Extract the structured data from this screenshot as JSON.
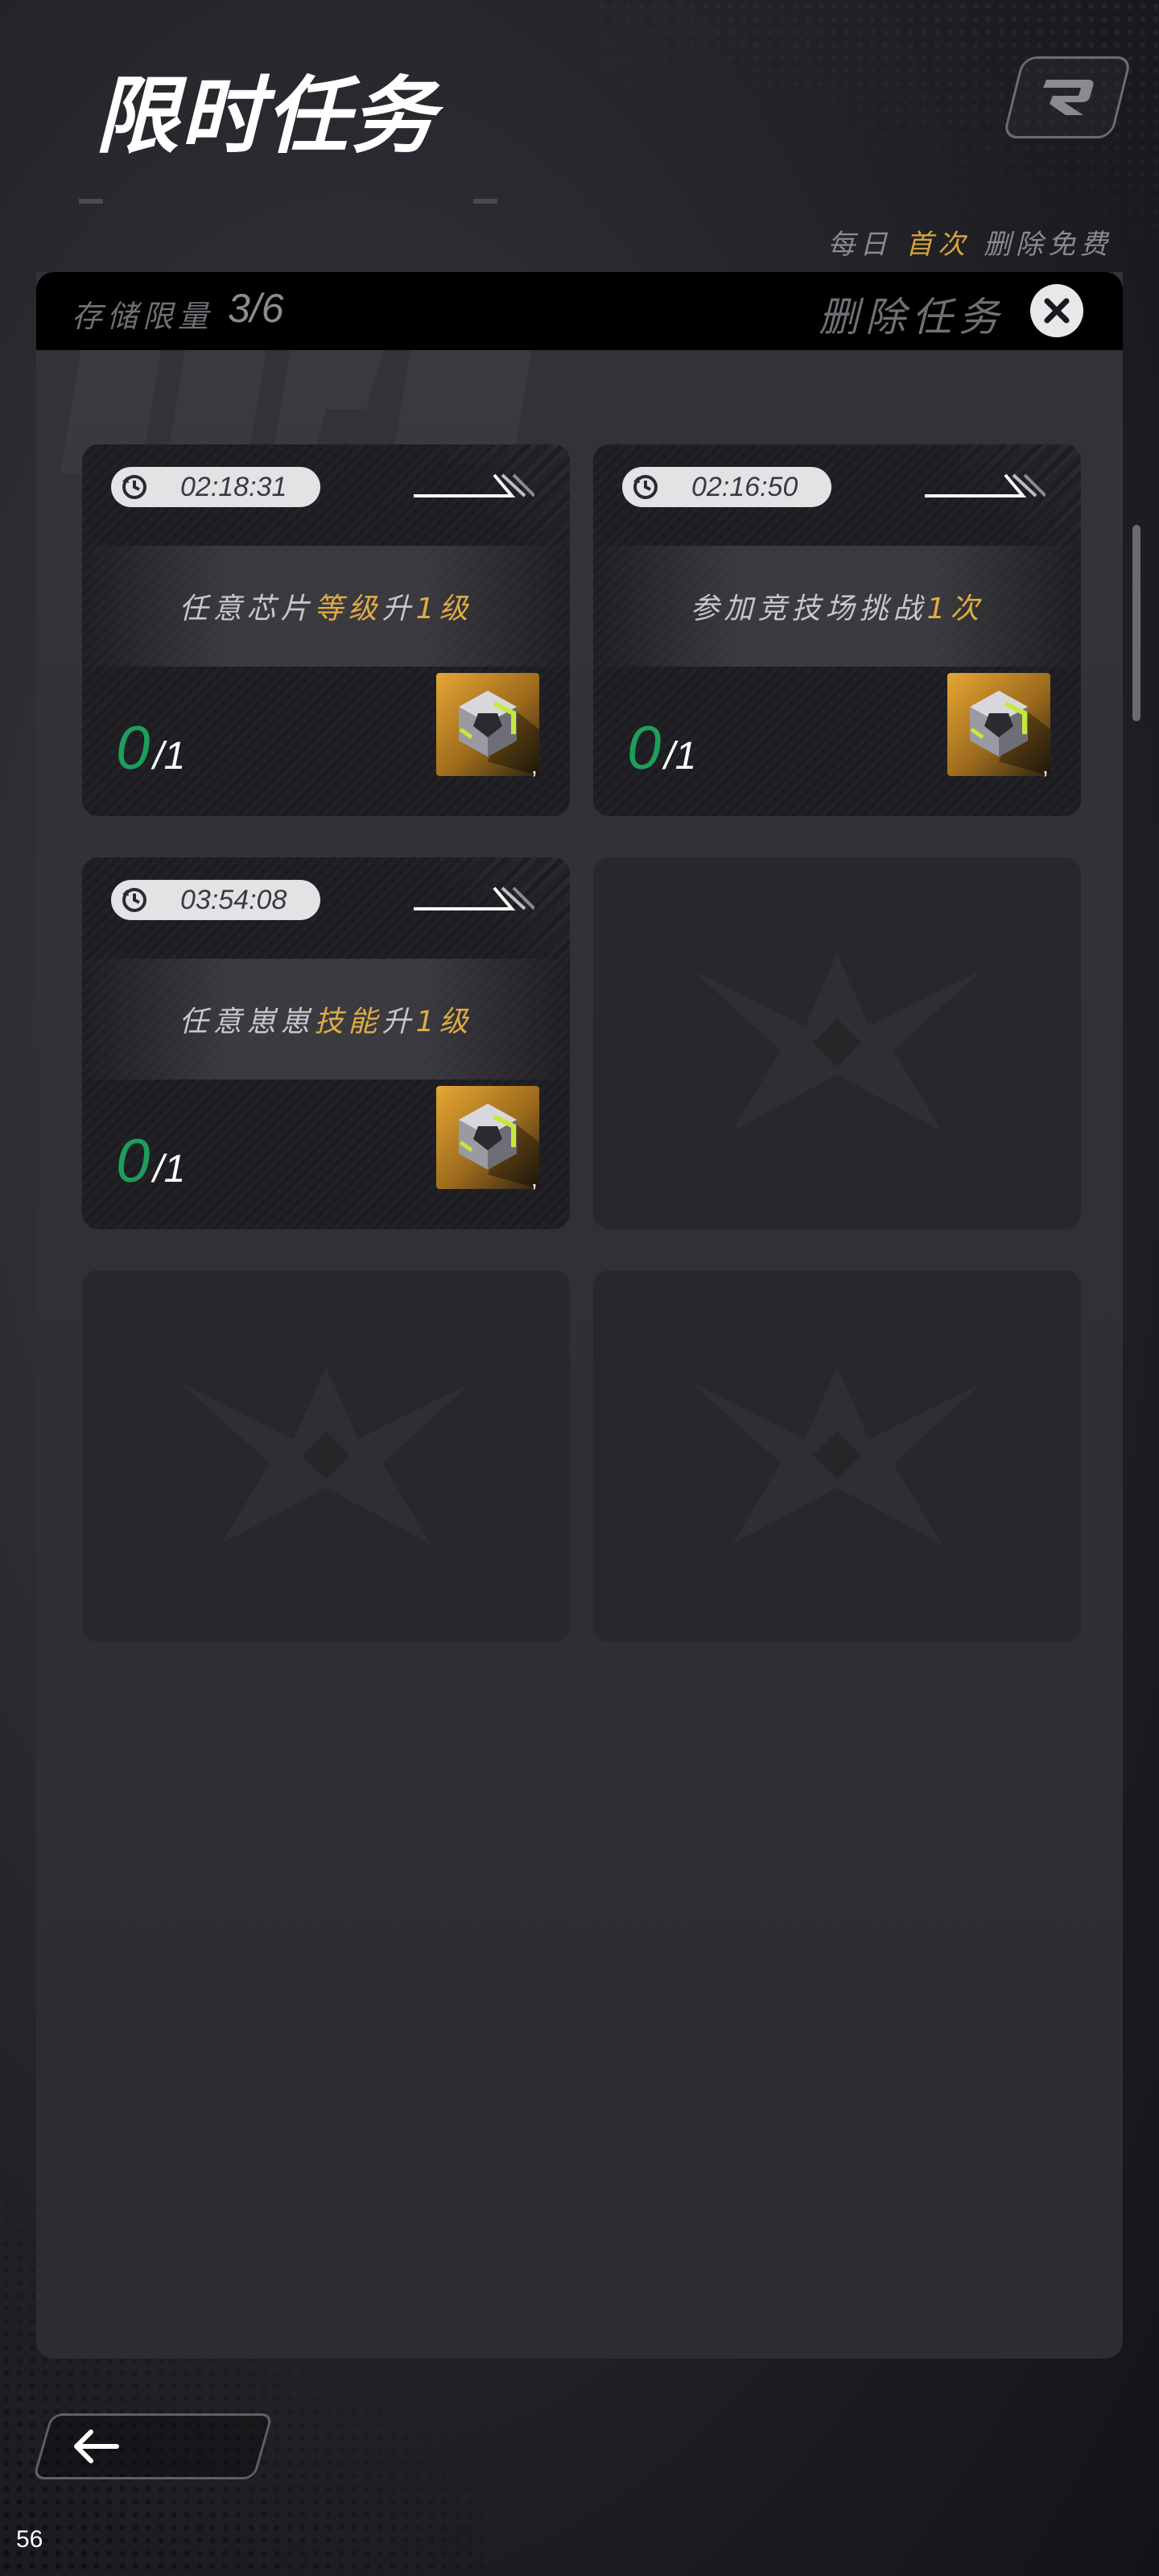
{
  "header": {
    "title": "限时任务",
    "subtitle_left": "",
    "subtitle_right": "",
    "corner_icon": "r-logo-icon",
    "daily_note": {
      "prefix": "每日",
      "highlight": "首次",
      "suffix": "删除免费"
    }
  },
  "panel": {
    "storage_label": "存储限量",
    "storage_value": "3/6",
    "delete_label": "删除任务",
    "close_icon": "close-icon"
  },
  "tasks": [
    {
      "timer": "02:18:31",
      "text_pre": "任意芯片",
      "text_hl1": "等级",
      "text_mid": "升",
      "text_hl2": "1",
      "text_post": "级",
      "progress_current": "0",
      "progress_sep": "/",
      "progress_total": "1",
      "reward_icon": "chip-cube-icon",
      "reward_count": ","
    },
    {
      "timer": "02:16:50",
      "text_pre": "参加竞技场挑战",
      "text_hl1": "",
      "text_mid": "",
      "text_hl2": "1",
      "text_post": "次",
      "progress_current": "0",
      "progress_sep": "/",
      "progress_total": "1",
      "reward_icon": "chip-cube-icon",
      "reward_count": ","
    },
    {
      "timer": "03:54:08",
      "text_pre": "任意崽崽",
      "text_hl1": "技能",
      "text_mid": "升",
      "text_hl2": "1",
      "text_post": "级",
      "progress_current": "0",
      "progress_sep": "/",
      "progress_total": "1",
      "reward_icon": "chip-cube-icon",
      "reward_count": ","
    }
  ],
  "empty_slot_icon": "star-emblem-icon",
  "footer": {
    "back_icon": "arrow-left-icon",
    "fps": "56"
  },
  "colors": {
    "accent_gold": "#e0ac45",
    "progress_green": "#1e9e5c",
    "panel_header": "#000000"
  }
}
